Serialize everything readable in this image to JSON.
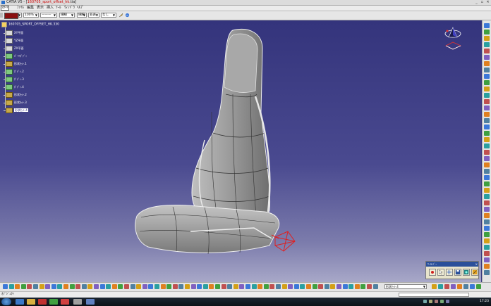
{
  "window": {
    "title_prefix": "CATIA V5 - [",
    "title_highlight": "160705_sport_offset_hk.",
    "title_suffix": "tia]",
    "controls": [
      "_",
      "▫",
      "✕"
    ]
  },
  "menu": {
    "start_label": "ｽﾀｰﾄ",
    "items": [
      "ﾌｧｲﾙ",
      "編集",
      "表示",
      "挿入",
      "ﾂｰﾙ",
      "ｳｨﾝﾄﾞｳ",
      "ﾍﾙﾌﾟ"
    ]
  },
  "properties_bar": {
    "color_hex": "#8a1010",
    "transparency_value": "100%",
    "linetype_value": "———",
    "thickness_value": "細線",
    "point_value": "細線",
    "layer_value": "非表",
    "layer2_value": "なし"
  },
  "tree": {
    "root_label": "160705_SPORT_OFFSET_HK.330",
    "items": [
      {
        "label": "XY平面",
        "icon": "plane-icon",
        "selected": false
      },
      {
        "label": "YZ平面",
        "icon": "plane-icon",
        "selected": false
      },
      {
        "label": "ZX平面",
        "icon": "plane-icon",
        "selected": false
      },
      {
        "label": "ﾊﾟｰﾂﾎﾞﾃﾞｨ",
        "icon": "geometry-icon",
        "selected": false
      },
      {
        "label": "形状ｾｯﾄ.1",
        "icon": "body-icon",
        "selected": false
      },
      {
        "label": "ﾎﾞﾃﾞｨ.2",
        "icon": "geometry-icon",
        "selected": false
      },
      {
        "label": "ﾎﾞﾃﾞｨ.3",
        "icon": "geometry-icon",
        "selected": false
      },
      {
        "label": "ﾎﾞﾃﾞｨ.4",
        "icon": "geometry-icon",
        "selected": false
      },
      {
        "label": "形状ｾｯﾄ.2",
        "icon": "body-icon",
        "selected": false
      },
      {
        "label": "形状ｾｯﾄ.3",
        "icon": "body-icon",
        "selected": false
      },
      {
        "label": "形状ｾｯﾄ.4",
        "icon": "body-icon",
        "selected": true
      }
    ]
  },
  "mini_toolbar": {
    "title": "ﾂｰﾙ ﾊﾞｰ",
    "close": "✕",
    "buttons": [
      "record-icon",
      "select-arrow-icon",
      "grid-icon",
      "save-icon",
      "view-icon",
      "zoom-icon"
    ]
  },
  "bottom_toolbar": {
    "dropdown_value": "形状ｾｯﾄ.4"
  },
  "status": {
    "text": "ｵﾌﾞｼﾞｪｸﾄ"
  },
  "taskbar": {
    "time": "17:23"
  }
}
